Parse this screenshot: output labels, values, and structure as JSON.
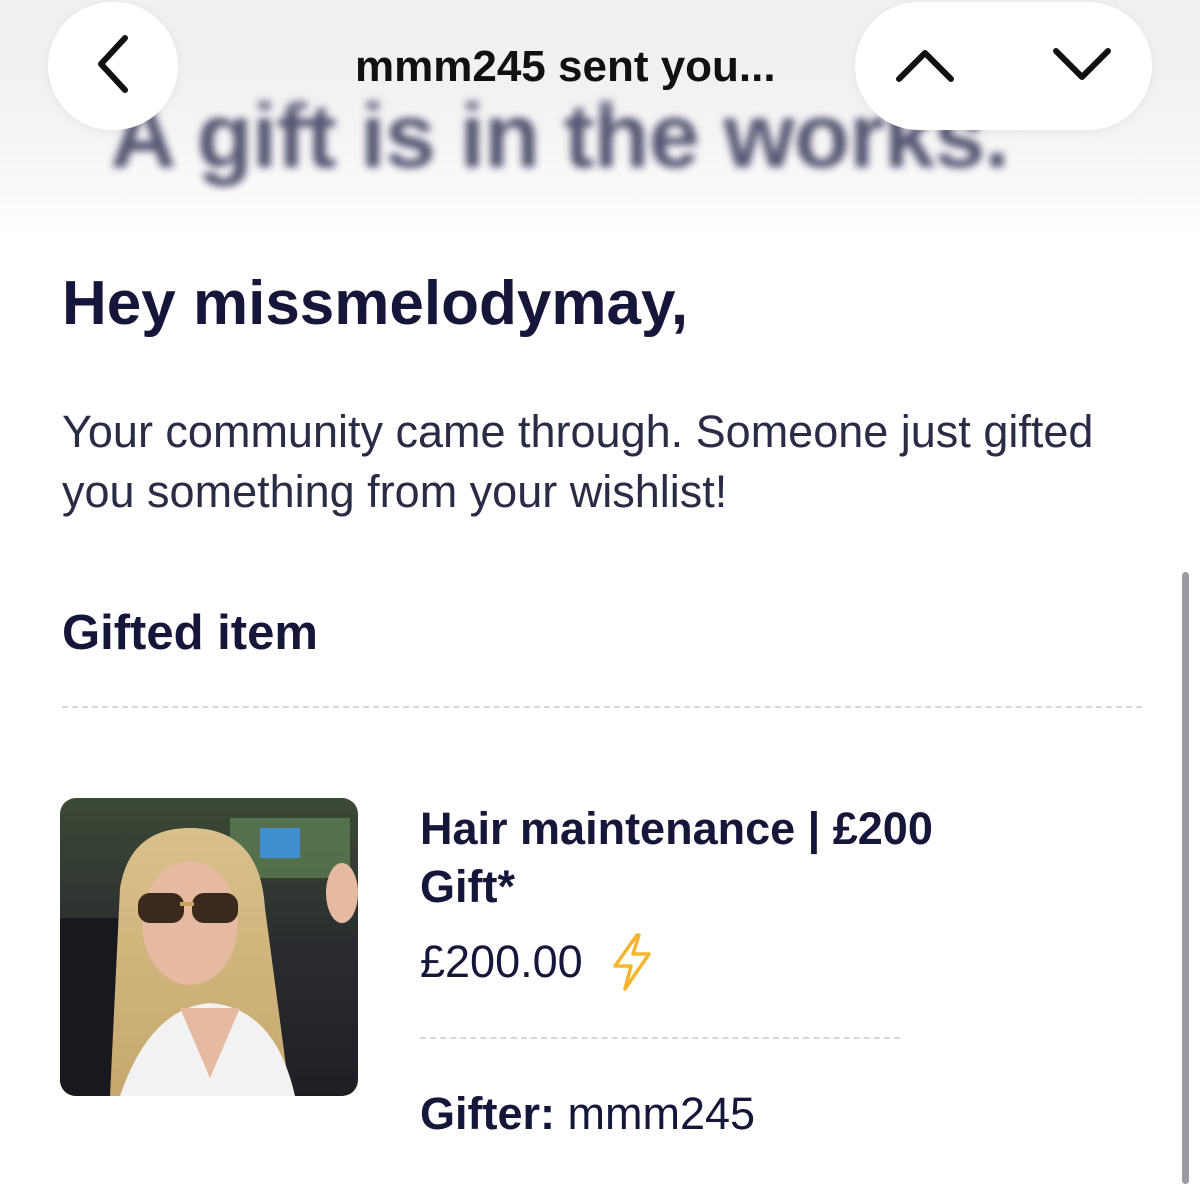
{
  "header": {
    "title": "mmm245 sent you...",
    "banner_headline": "A gift is in the works."
  },
  "content": {
    "greeting": "Hey missmelodymay,",
    "message": "Your community came through. Someone just gifted you something from your wishlist!",
    "section_title": "Gifted item"
  },
  "item": {
    "name": "Hair maintenance | £200 Gift*",
    "price": "£200.00",
    "price_icon": "lightning-bolt-icon",
    "gifter_label": "Gifter:",
    "gifter_value": " mmm245"
  },
  "icons": {
    "back": "chevron-left-icon",
    "previous": "chevron-up-icon",
    "next": "chevron-down-icon"
  },
  "colors": {
    "text_primary": "#15163a",
    "bolt": "#f5b52e",
    "background": "#ffffff"
  }
}
